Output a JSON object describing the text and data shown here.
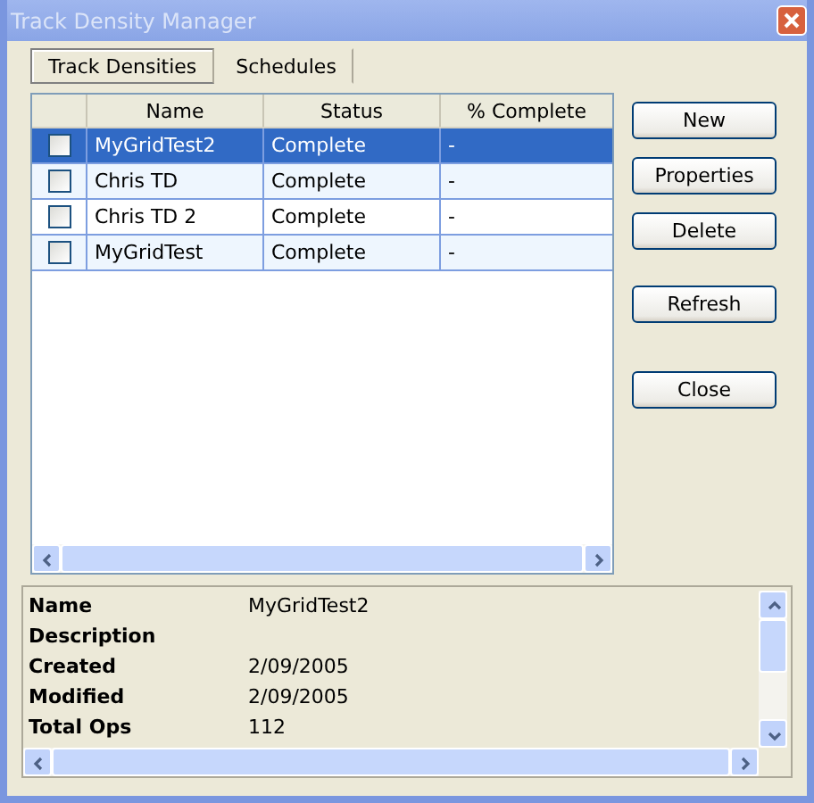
{
  "window": {
    "title": "Track Density Manager"
  },
  "tabs": [
    {
      "label": "Track Densities",
      "selected": true
    },
    {
      "label": "Schedules",
      "selected": false
    }
  ],
  "table": {
    "columns": [
      "Name",
      "Status",
      "% Complete"
    ],
    "rows": [
      {
        "checked": false,
        "selected": true,
        "cells": [
          "MyGridTest2",
          "Complete",
          "-"
        ]
      },
      {
        "checked": false,
        "selected": false,
        "cells": [
          "Chris TD",
          "Complete",
          "-"
        ]
      },
      {
        "checked": false,
        "selected": false,
        "cells": [
          "Chris TD 2",
          "Complete",
          "-"
        ]
      },
      {
        "checked": false,
        "selected": false,
        "cells": [
          "MyGridTest",
          "Complete",
          "-"
        ]
      }
    ]
  },
  "buttons": [
    "New",
    "Properties",
    "Delete",
    "Refresh",
    "Close"
  ],
  "details": [
    {
      "label": "Name",
      "value": "MyGridTest2"
    },
    {
      "label": "Description"
    },
    {
      "label": "Created",
      "value": "2/09/2005"
    },
    {
      "label": "Modified",
      "value": "2/09/2005"
    },
    {
      "label": "Total Ops",
      "value": "112"
    }
  ]
}
